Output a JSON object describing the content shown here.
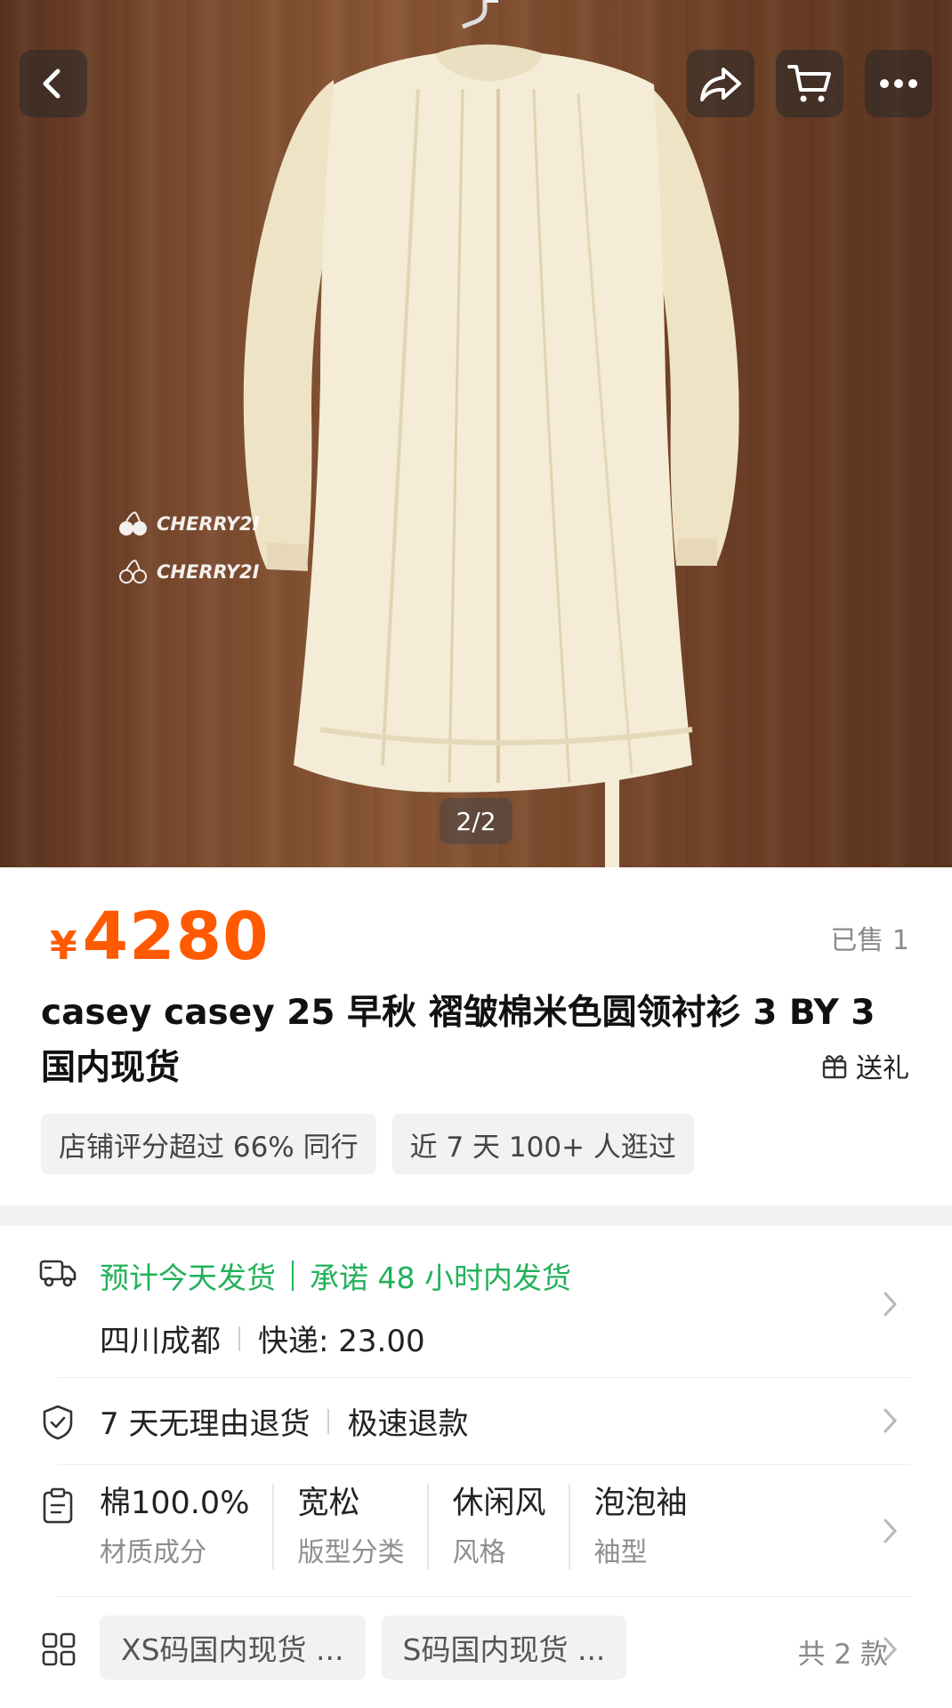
{
  "gallery": {
    "counter": "2/2",
    "watermark_1": "CHERRY2I",
    "watermark_2": "CHERRY2I"
  },
  "top_actions": [
    "back-icon",
    "share-icon",
    "cart-icon",
    "more-icon"
  ],
  "product": {
    "currency": "¥",
    "price": "4280",
    "sold": "已售 1",
    "title": "casey casey 25 早秋 褶皱棉米色圆领衬衫 3 BY 3 国内现货",
    "gift": "送礼",
    "chips": [
      "店铺评分超过 66% 同行",
      "近 7 天 100+ 人逛过"
    ]
  },
  "shipping": {
    "promise_1": "预计今天发货",
    "promise_2": "承诺 48 小时内发货",
    "location": "四川成都",
    "fee": "快递:  23.00"
  },
  "returns": {
    "policy": "7 天无理由退货",
    "refund": "极速退款"
  },
  "attributes": [
    {
      "value": "棉100.0%",
      "key": "材质成分"
    },
    {
      "value": "宽松",
      "key": "版型分类"
    },
    {
      "value": "休闲风",
      "key": "风格"
    },
    {
      "value": "泡泡袖",
      "key": "袖型"
    }
  ],
  "skus": {
    "items": [
      "XS码国内现货 ...",
      "S码国内现货 ..."
    ],
    "total": "共 2 款"
  },
  "colors": {
    "price": "#ff5a00",
    "ship_green": "#22b15a",
    "wood": "#7a4a2e",
    "dress": "#f3ead4"
  }
}
